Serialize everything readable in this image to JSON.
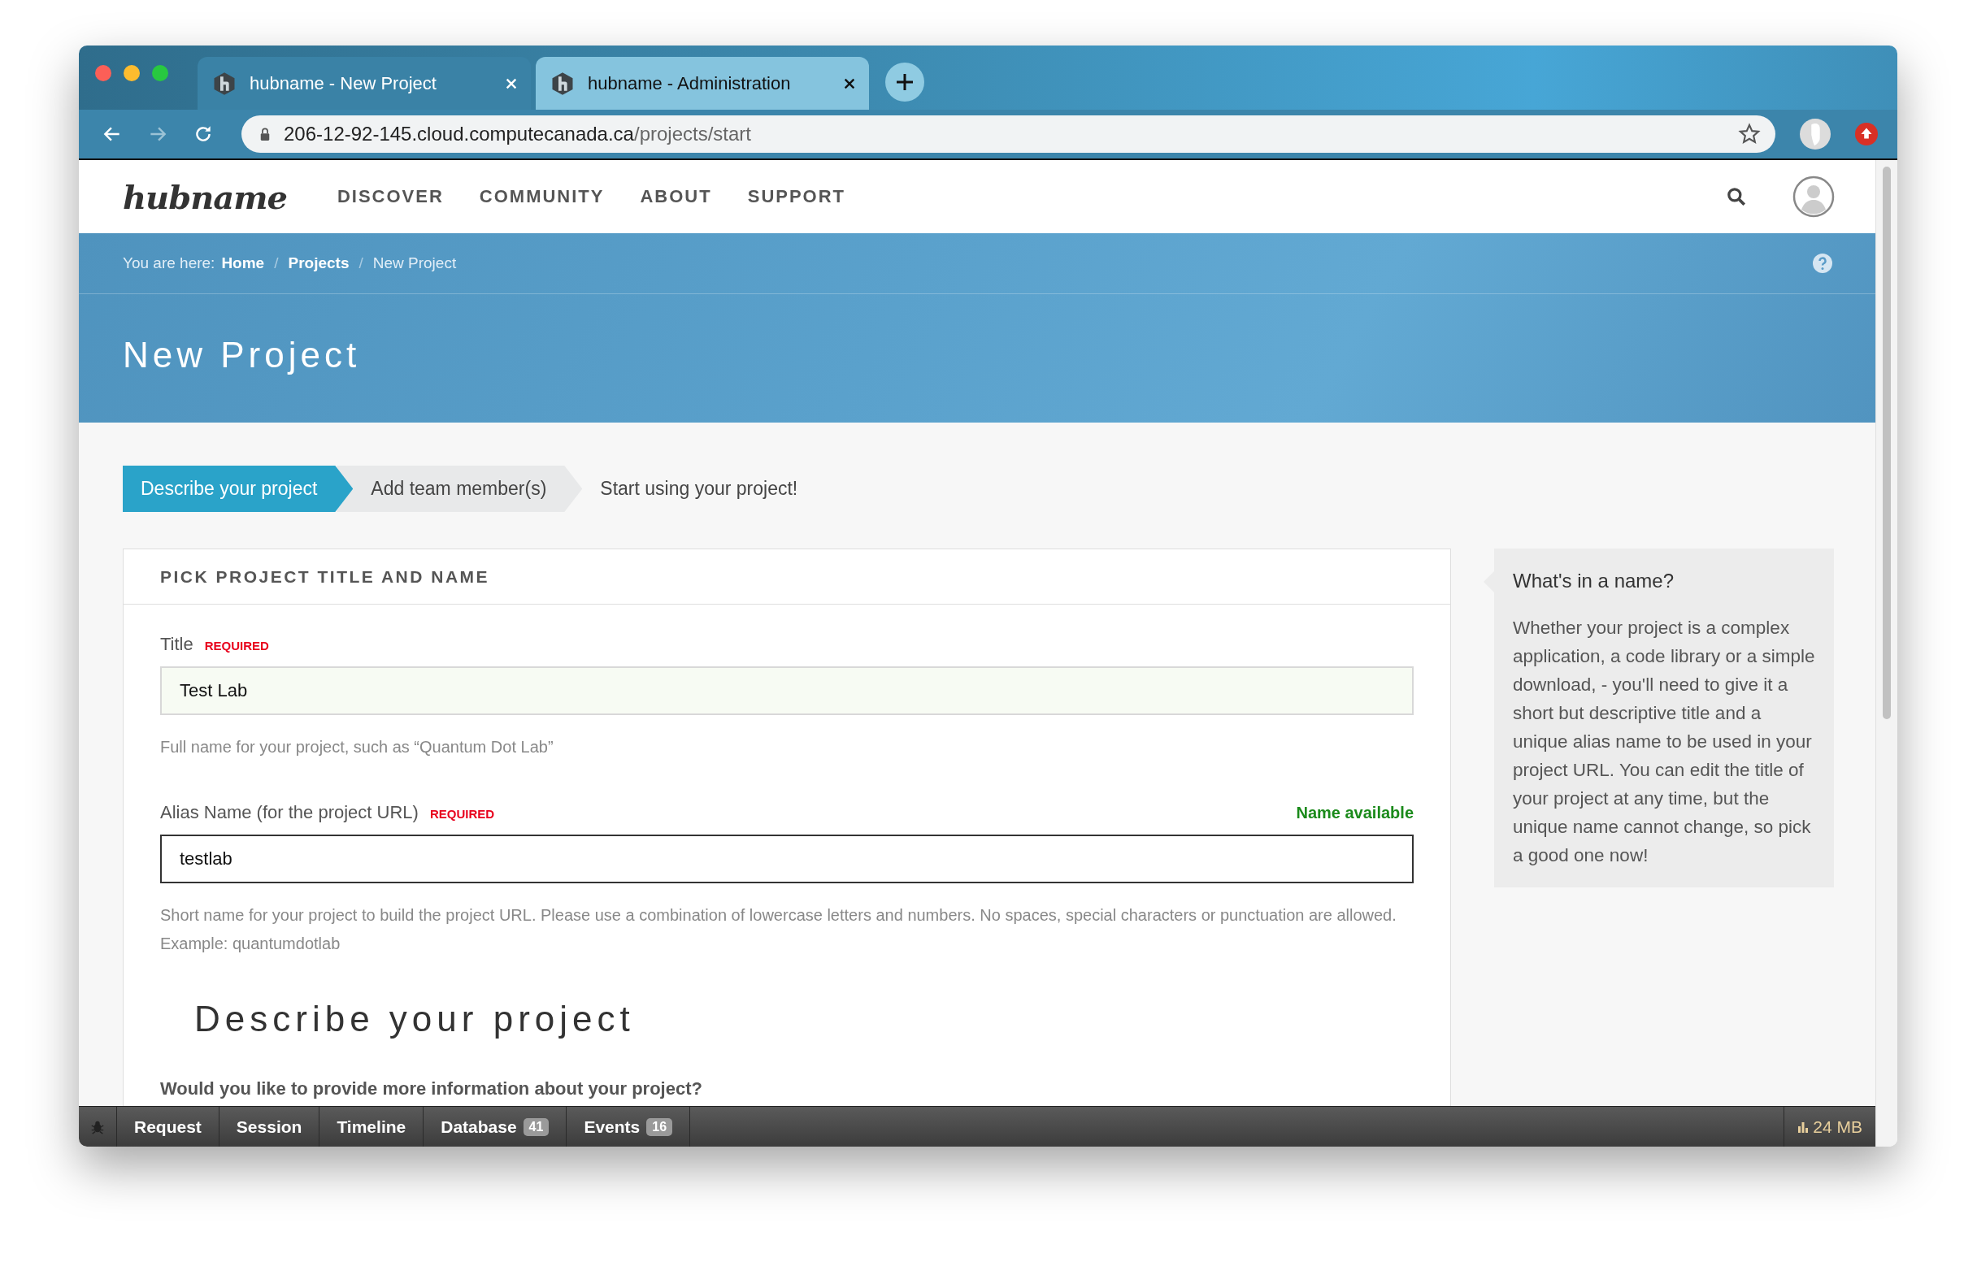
{
  "browser": {
    "tabs": [
      {
        "title": "hubname - New Project",
        "selected": true
      },
      {
        "title": "hubname - Administration",
        "selected": false
      }
    ],
    "url": {
      "host": "206-12-92-145.cloud.computecanada.ca",
      "path": "/projects/start"
    }
  },
  "header": {
    "logo": "hubname",
    "nav": [
      "DISCOVER",
      "COMMUNITY",
      "ABOUT",
      "SUPPORT"
    ]
  },
  "breadcrumb": [
    {
      "label": "You are here:",
      "kind": "prefix"
    },
    {
      "label": "Home",
      "kind": "link"
    },
    {
      "label": "/",
      "kind": "separator"
    },
    {
      "label": "Projects",
      "kind": "link"
    },
    {
      "label": "/",
      "kind": "separator"
    },
    {
      "label": "New Project",
      "kind": "current"
    }
  ],
  "page_title": "New Project",
  "steps": [
    {
      "label": "Describe your project",
      "selected": true,
      "kind": "arrow"
    },
    {
      "label": "Add team member(s)",
      "selected": false,
      "kind": "arrow"
    },
    {
      "label": "Start using your project!",
      "selected": false,
      "kind": "plain"
    }
  ],
  "form": {
    "section_title": "PICK PROJECT TITLE AND NAME",
    "fields": [
      {
        "label": "Title",
        "badge": "REQUIRED",
        "value": "Test Lab",
        "focused": false,
        "hint": "Full name for your project, such as “Quantum Dot Lab”"
      },
      {
        "label": "Alias Name (for the project URL)",
        "badge": "REQUIRED",
        "status": "Name available",
        "value": "testlab",
        "focused": true,
        "hint": "Short name for your project to build the project URL. Please use a combination of lowercase letters and numbers. No spaces, special characters or punctuation are allowed. Example: quantumdotlab"
      }
    ],
    "describe_heading": "Describe your project",
    "question": "Would you like to provide more information about your project?"
  },
  "sidebar": {
    "title": "What's in a name?",
    "body": "Whether your project is a complex application, a code library or a simple download, - you'll need to give it a short but descriptive title and a unique alias name to be used in your project URL. You can edit the title of your project at any time, but the unique name cannot change, so pick a good one now!"
  },
  "debug_bar": {
    "items": [
      {
        "label": "Request"
      },
      {
        "label": "Session"
      },
      {
        "label": "Timeline"
      },
      {
        "label": "Database",
        "count": "41"
      },
      {
        "label": "Events",
        "count": "16"
      }
    ],
    "memory": "24 MB"
  }
}
